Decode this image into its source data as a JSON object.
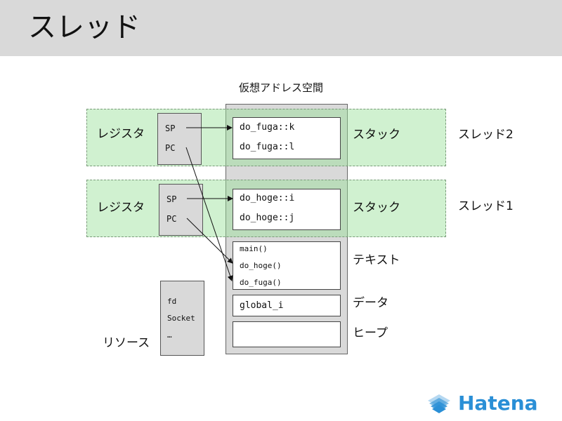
{
  "title": "スレッド",
  "address_space_label": "仮想アドレス空間",
  "thread2": {
    "label": "スレッド2",
    "register_label": "レジスタ",
    "stack_label": "スタック",
    "registers": [
      "SP",
      "PC"
    ],
    "stack_frames": [
      "do_fuga::k",
      "do_fuga::l"
    ]
  },
  "thread1": {
    "label": "スレッド1",
    "register_label": "レジスタ",
    "stack_label": "スタック",
    "registers": [
      "SP",
      "PC"
    ],
    "stack_frames": [
      "do_hoge::i",
      "do_hoge::j"
    ]
  },
  "text_segment": {
    "label": "テキスト",
    "functions": [
      "main()",
      "do_hoge()",
      "do_fuga()"
    ]
  },
  "data_segment": {
    "label": "データ",
    "items": [
      "global_i"
    ]
  },
  "heap_segment": {
    "label": "ヒープ"
  },
  "resources": {
    "label": "リソース",
    "items": [
      "fd",
      "Socket",
      "…"
    ]
  },
  "colors": {
    "thread_band": "#96e196",
    "header": "#d9d9d9",
    "logo": "#2a8fd6"
  },
  "logo": {
    "text": "Hatena",
    "icon": "hatena-diamond-icon"
  }
}
